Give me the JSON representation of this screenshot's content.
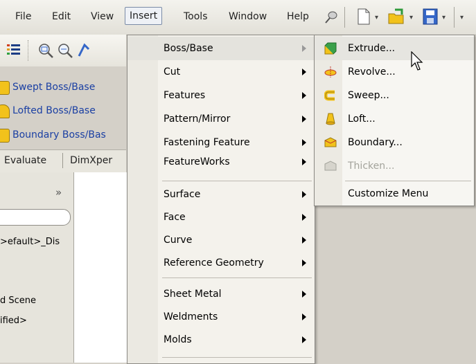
{
  "menubar": {
    "items": [
      "File",
      "Edit",
      "View",
      "Insert",
      "Tools",
      "Window",
      "Help"
    ]
  },
  "left_commands": [
    {
      "label": "Swept Boss/Base",
      "icon": "swept-boss-icon"
    },
    {
      "label": "Lofted Boss/Base",
      "icon": "lofted-boss-icon"
    },
    {
      "label": "Boundary Boss/Bas",
      "icon": "boundary-boss-icon"
    }
  ],
  "tabs": [
    "Evaluate",
    "DimXper"
  ],
  "panel": {
    "chevron": "»",
    "tree": [
      ">efault>_Dis",
      "d Scene",
      "ified>"
    ]
  },
  "insert_menu": {
    "items": [
      {
        "label": "Boss/Base",
        "has_sub": true,
        "active": true
      },
      {
        "label": "Cut",
        "has_sub": true
      },
      {
        "label": "Features",
        "has_sub": true
      },
      {
        "label": "Pattern/Mirror",
        "has_sub": true
      },
      {
        "label": "Fastening Feature",
        "has_sub": true
      },
      {
        "label": "FeatureWorks",
        "has_sub": true
      },
      {
        "label": "Surface",
        "has_sub": true
      },
      {
        "label": "Face",
        "has_sub": true
      },
      {
        "label": "Curve",
        "has_sub": true
      },
      {
        "label": "Reference Geometry",
        "has_sub": true
      },
      {
        "label": "Sheet Metal",
        "has_sub": true
      },
      {
        "label": "Weldments",
        "has_sub": true
      },
      {
        "label": "Molds",
        "has_sub": true
      }
    ]
  },
  "boss_submenu": {
    "items": [
      {
        "label": "Extrude...",
        "icon": "extrude-icon",
        "hover": true
      },
      {
        "label": "Revolve...",
        "icon": "revolve-icon"
      },
      {
        "label": "Sweep...",
        "icon": "sweep-icon"
      },
      {
        "label": "Loft...",
        "icon": "loft-icon"
      },
      {
        "label": "Boundary...",
        "icon": "boundary-icon"
      },
      {
        "label": "Thicken...",
        "icon": "thicken-icon",
        "disabled": true
      }
    ],
    "customize": "Customize Menu"
  },
  "colors": {
    "accent_blue": "#1a3fa3",
    "menu_bg": "#f4f2ec",
    "highlight": "#e4e3dd",
    "disabled": "#a3a39b",
    "icon_yellow": "#f2c21b",
    "icon_green": "#3aa04a"
  }
}
